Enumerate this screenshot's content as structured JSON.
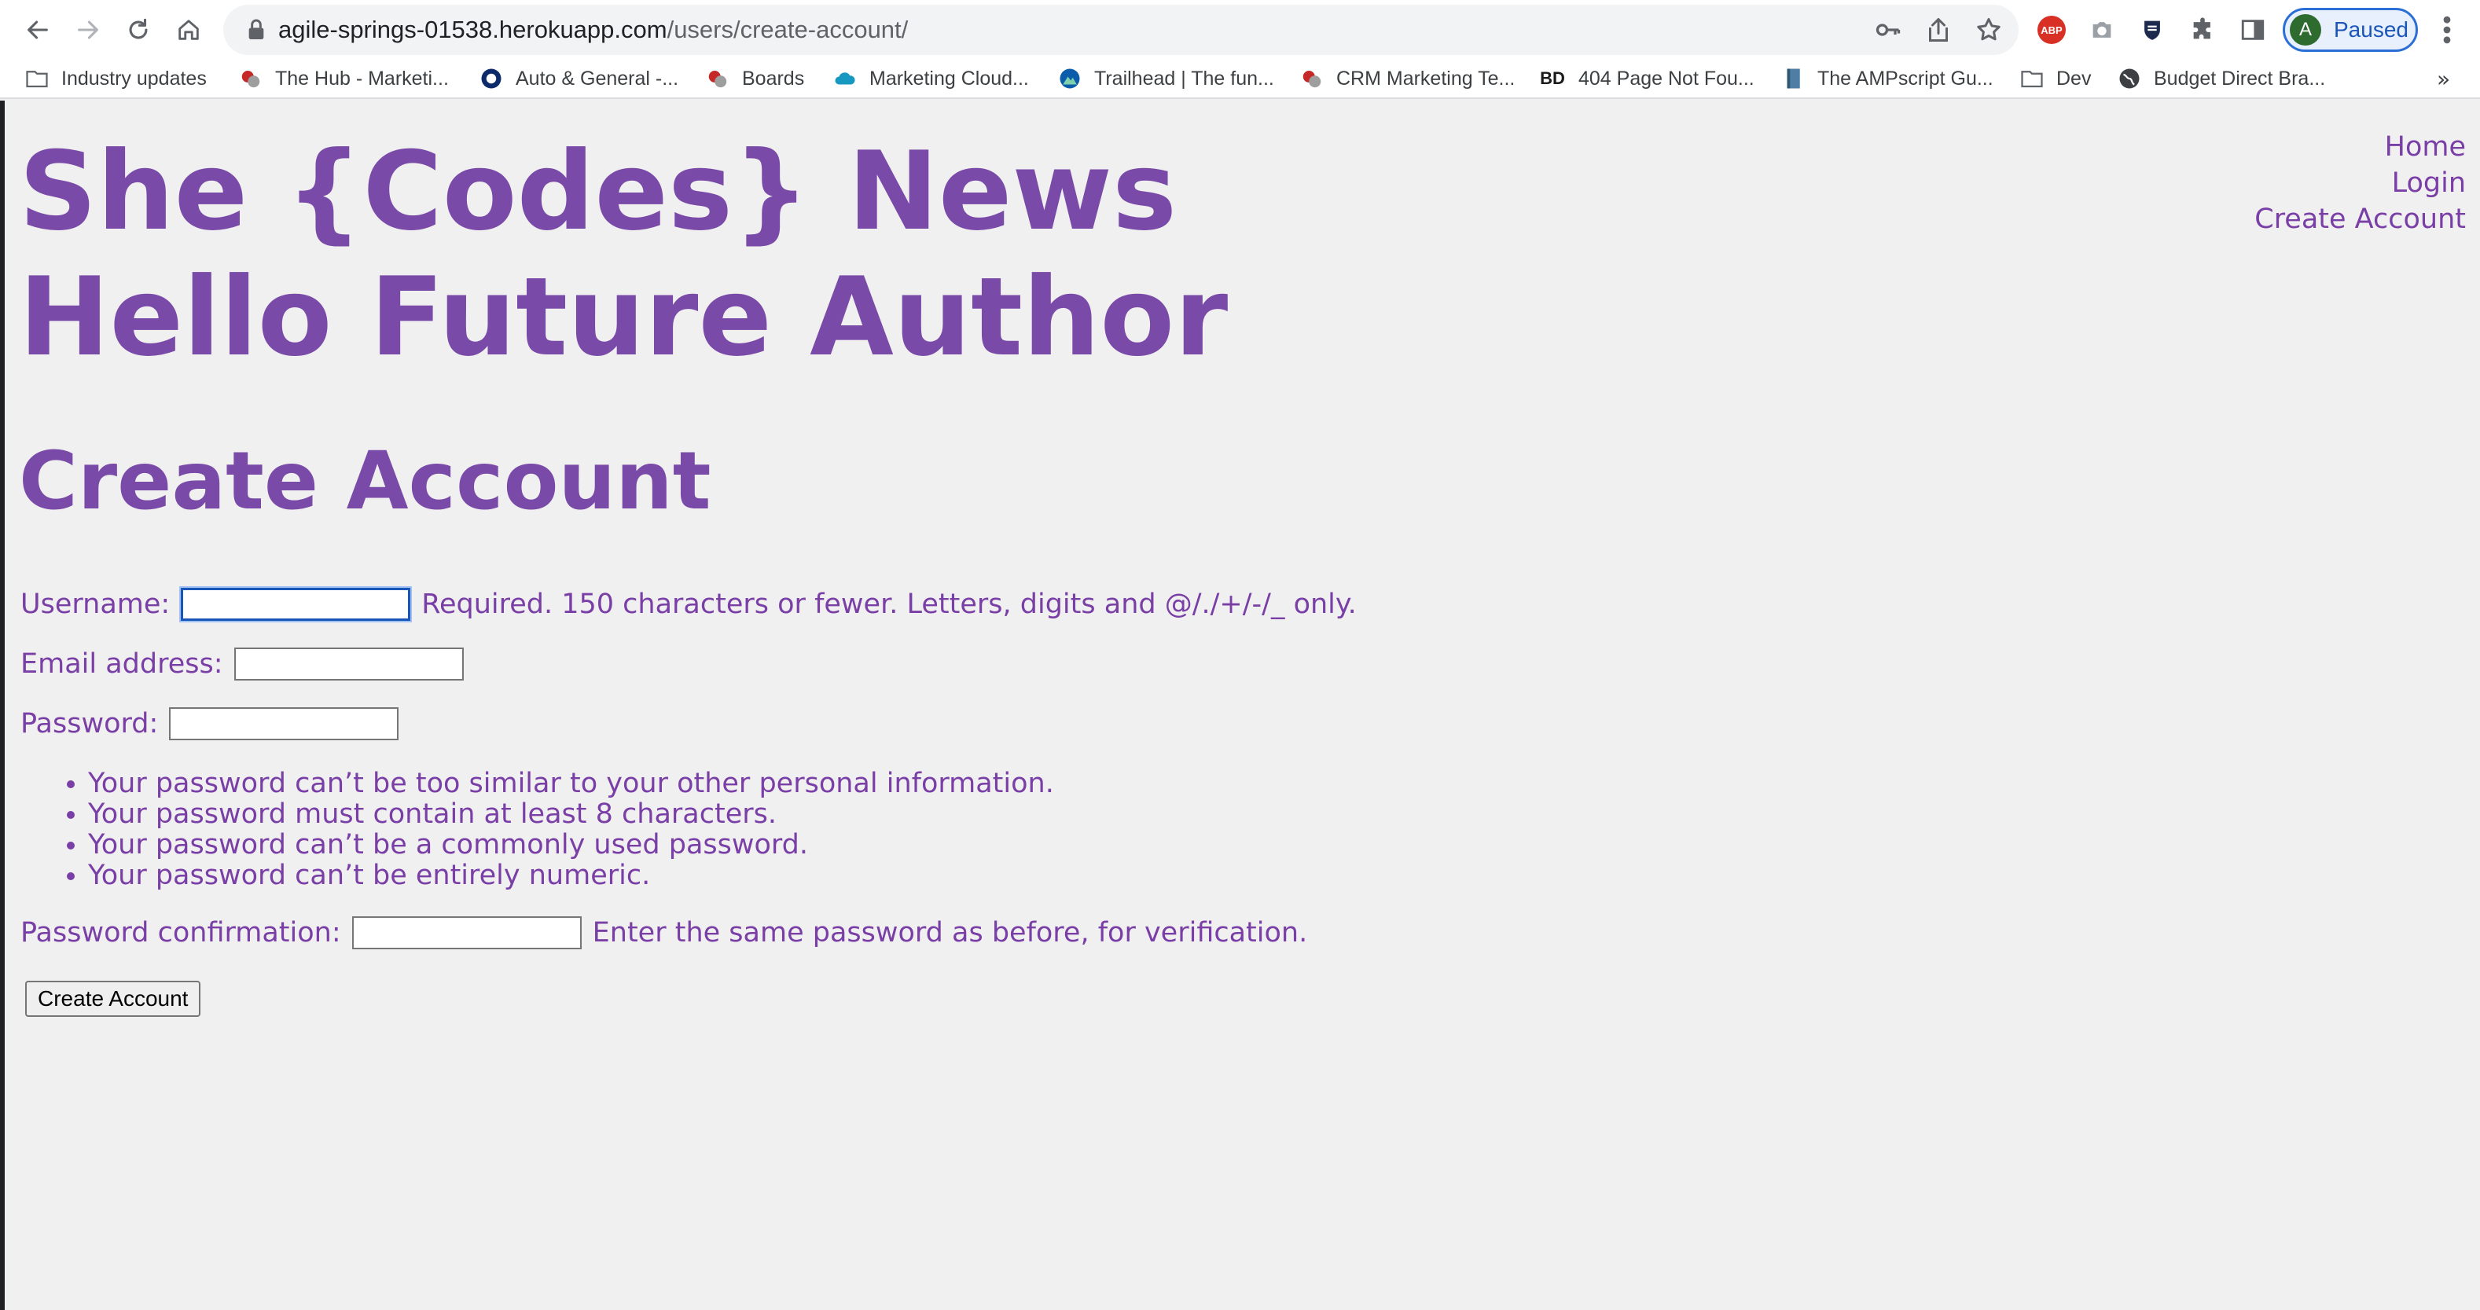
{
  "browser": {
    "url_host": "agile-springs-01538.herokuapp.com",
    "url_path": "/users/create-account/",
    "profile_initial": "A",
    "profile_status": "Paused",
    "abp_label": "ABP",
    "bookmarks_overflow": "»",
    "bookmarks": [
      {
        "label": "Industry updates",
        "icon": "folder-icon"
      },
      {
        "label": "The Hub - Marketi...",
        "icon": "site-favicon"
      },
      {
        "label": "Auto & General -...",
        "icon": "site-favicon"
      },
      {
        "label": "Boards",
        "icon": "site-favicon"
      },
      {
        "label": "Marketing Cloud...",
        "icon": "cloud-icon"
      },
      {
        "label": "Trailhead | The fun...",
        "icon": "site-favicon"
      },
      {
        "label": "CRM Marketing Te...",
        "icon": "site-favicon"
      },
      {
        "label": "404 Page Not Fou...",
        "icon": "bd-icon",
        "icon_text": "BD"
      },
      {
        "label": "The AMPscript Gu...",
        "icon": "book-icon"
      },
      {
        "label": "Dev",
        "icon": "folder-icon"
      },
      {
        "label": "Budget Direct Bra...",
        "icon": "globe-icon"
      }
    ]
  },
  "site": {
    "title": "She {Codes} News",
    "greeting": "Hello Future Author",
    "nav": {
      "home": "Home",
      "login": "Login",
      "create_account": "Create Account"
    }
  },
  "form": {
    "heading": "Create Account",
    "username_label": "Username:",
    "username_help": "Required. 150 characters or fewer. Letters, digits and @/./+/-/_ only.",
    "email_label": "Email address:",
    "password_label": "Password:",
    "password_rules": [
      "Your password can’t be too similar to your other personal information.",
      "Your password must contain at least 8 characters.",
      "Your password can’t be a commonly used password.",
      "Your password can’t be entirely numeric."
    ],
    "confirm_label": "Password confirmation:",
    "confirm_help": "Enter the same password as before, for verification.",
    "submit_label": "Create Account"
  },
  "colors": {
    "accent": "#7a3fa6",
    "background": "#f0f0f0"
  }
}
